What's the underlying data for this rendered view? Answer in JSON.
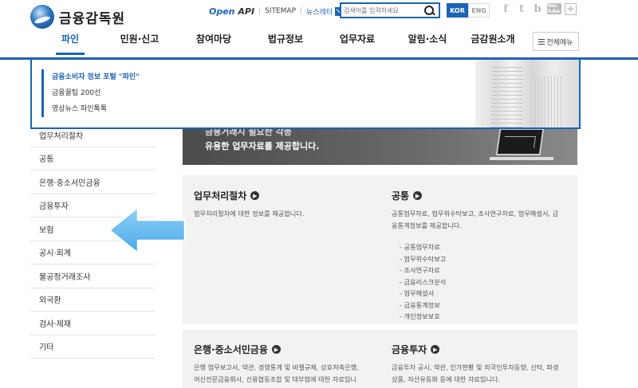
{
  "header": {
    "logo_text": "금융감독원",
    "openapi_a": "Open",
    "openapi_b": "API",
    "sitemap": "SITEMAP",
    "newsletter": "뉴스레터",
    "search_placeholder": "검색어를 입력하세요",
    "lang_kor": "KOR",
    "lang_eng": "ENG",
    "social": {
      "facebook": "f",
      "twitter": "t",
      "blog": "b",
      "youtube": "You Tube",
      "more": "+"
    }
  },
  "gnb": {
    "items": [
      "파인",
      "민원·신고",
      "참여마당",
      "법규정보",
      "업무자료",
      "알림·소식",
      "금감원소개"
    ],
    "all_menu": "전체메뉴"
  },
  "dropdown": {
    "items": [
      "금융소비자 정보 포털 \"파인\"",
      "금융꿀팁 200선",
      "영상뉴스 파인톡톡"
    ]
  },
  "lnb": {
    "items": [
      "업무처리절차",
      "공통",
      "은행·중소서민금융",
      "금융투자",
      "보험",
      "공시·회계",
      "불공정거래조사",
      "외국환",
      "검사·제재",
      "기타"
    ]
  },
  "banner": {
    "line1": "금융거래시 필요한 각종",
    "line2": "유용한 업무자료를 제공합니다."
  },
  "sections": {
    "process": {
      "title": "업무처리절차",
      "desc": "업무처리절차에 대한 정보를 제공합니다."
    },
    "common": {
      "title": "공통",
      "desc": "공통업무자료, 업무위수탁보고, 조사연구자료, 업무해설서, 금융통계정보를 제공합니다.",
      "list": [
        "- 공통업무자료",
        "- 업무위수탁보고",
        "- 조사연구자료",
        "- 금융리스크분석",
        "- 업무해설서",
        "- 금융통계정보",
        "- 개인정보보호"
      ]
    },
    "bank": {
      "title": "은행·중소서민금융",
      "desc": "은행 업무보고서, 약관, 경영통계 및 바젤규제, 상호저축은행, 여신전문금융회사, 신용협동조합 및 대부업에 대한 자료입니다."
    },
    "invest": {
      "title": "금융투자",
      "desc": "금융투자 공시, 약관, 인가현황 및 외국인투자동향, 신탁, 파생상품, 자산유동화 등에 대한 자료입니다."
    }
  },
  "colors": {
    "accent": "#1b63b5",
    "arrow": "#5fb6ee"
  }
}
